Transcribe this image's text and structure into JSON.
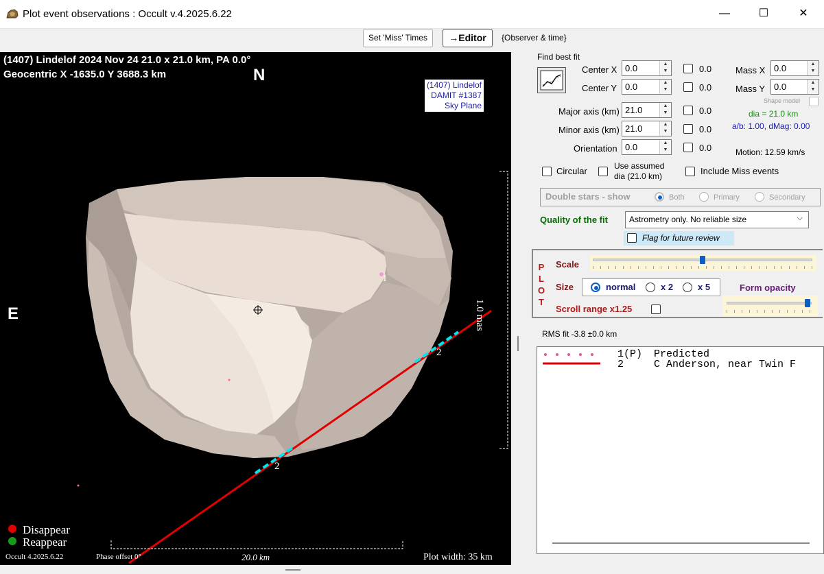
{
  "window": {
    "title": "Plot event observations : Occult v.4.2025.6.22",
    "minimize": "—",
    "maximize": "☐",
    "close": "✕"
  },
  "toolbar": {
    "set_miss_times": "Set 'Miss' Times",
    "editor": "→Editor",
    "observer_time": "{Observer & time}"
  },
  "plot": {
    "header_line1": "(1407) Lindelof  2024 Nov 24   21.0 x 21.0 km, PA 0.0°",
    "header_line2": "Geocentric  X  -1635.0  Y 3688.3 km",
    "north": "N",
    "east": "E",
    "badge_line1": "(1407) Lindelof",
    "badge_line2": "DAMIT #1387",
    "badge_line3": "Sky Plane",
    "scale_label": "1.0 mas",
    "chord_label_1": "1",
    "chord_label_2a": "2",
    "chord_label_2b": "2",
    "legend_disappear": "Disappear",
    "legend_reappear": "Reappear",
    "footer_version": "Occult 4.2025.6.22",
    "footer_phase": "Phase offset 0°",
    "footer_scale": "20.0 km",
    "footer_width": "Plot width: 35 km",
    "colors": {
      "disappear": "#e00000",
      "reappear": "#1a9a1a",
      "chord": "#e00000",
      "segment": "#00e5ee"
    }
  },
  "fit": {
    "group_title": "Find best fit",
    "center_x_label": "Center X",
    "center_x": "0.0",
    "center_x_unc": "0.0",
    "center_y_label": "Center Y",
    "center_y": "0.0",
    "center_y_unc": "0.0",
    "major_label": "Major axis (km)",
    "major": "21.0",
    "major_unc": "0.0",
    "minor_label": "Minor axis (km)",
    "minor": "21.0",
    "minor_unc": "0.0",
    "orient_label": "Orientation",
    "orient": "0.0",
    "orient_unc": "0.0",
    "mass_x_label": "Mass X",
    "mass_x": "0.0",
    "mass_y_label": "Mass Y",
    "mass_y": "0.0",
    "shape_model": "Shape model",
    "dia": "dia = 21.0 km",
    "ab": "a/b: 1.00, dMag: 0.00",
    "motion": "Motion: 12.59 km/s",
    "circular": "Circular",
    "use_assumed": "Use assumed",
    "use_assumed_2": "dia (21.0 km)",
    "include_miss": "Include Miss events"
  },
  "double_stars": {
    "label": "Double stars - show",
    "both": "Both",
    "primary": "Primary",
    "secondary": "Secondary"
  },
  "quality": {
    "label": "Quality of the fit",
    "value": "Astrometry only. No reliable size",
    "flag": "Flag for future review"
  },
  "plot_controls": {
    "plot_letters": [
      "P",
      "L",
      "O",
      "T"
    ],
    "scale": "Scale",
    "size": "Size",
    "normal": "normal",
    "x2": "x 2",
    "x5": "x 5",
    "form_opacity": "Form opacity",
    "scroll_range": "Scroll range x1.25",
    "scale_level": 0.5,
    "opacity_level": 0.98
  },
  "rms": {
    "label": "RMS fit -3.8 ±0.0 km"
  },
  "legend_list": {
    "row1_id": "1(P)",
    "row1_text": "Predicted",
    "row2_id": "2",
    "row2_text": "C Anderson, near Twin F"
  }
}
